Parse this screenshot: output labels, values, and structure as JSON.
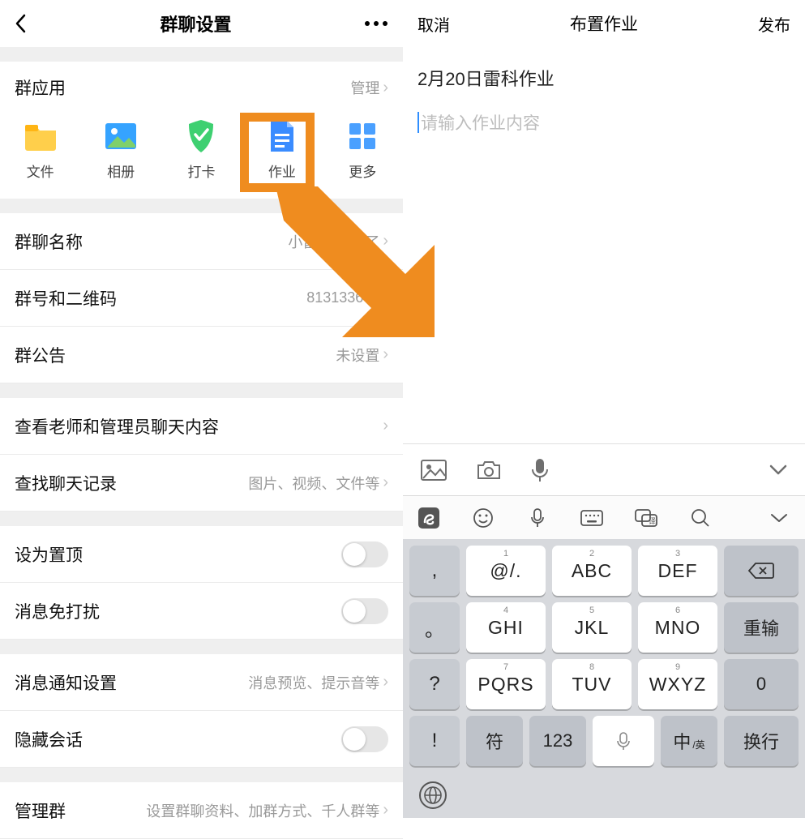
{
  "left": {
    "header_title": "群聊设置",
    "apps_section": {
      "title": "群应用",
      "manage": "管理"
    },
    "apps": [
      {
        "label": "文件"
      },
      {
        "label": "相册"
      },
      {
        "label": "打卡"
      },
      {
        "label": "作业"
      },
      {
        "label": "更多"
      }
    ],
    "rows": {
      "name": {
        "label": "群聊名称",
        "value": "小雷      堂开课了"
      },
      "id": {
        "label": "群号和二维码",
        "value": "813133646"
      },
      "announce": {
        "label": "群公告",
        "value": "未设置"
      },
      "view_admin": {
        "label": "查看老师和管理员聊天内容"
      },
      "search": {
        "label": "查找聊天记录",
        "value": "图片、视频、文件等"
      },
      "pin": {
        "label": "设为置顶"
      },
      "mute": {
        "label": "消息免打扰"
      },
      "notify": {
        "label": "消息通知设置",
        "value": "消息预览、提示音等"
      },
      "hide": {
        "label": "隐藏会话"
      },
      "manage": {
        "label": "管理群",
        "value": "设置群聊资料、加群方式、千人群等"
      }
    }
  },
  "right": {
    "cancel": "取消",
    "title": "布置作业",
    "publish": "发布",
    "subject": "2月20日雷科作业",
    "body_placeholder": "请输入作业内容"
  },
  "keyboard": {
    "punct": [
      ",",
      "。",
      "?",
      "!"
    ],
    "keys": [
      {
        "sup": "1",
        "main": "@/."
      },
      {
        "sup": "2",
        "main": "ABC"
      },
      {
        "sup": "3",
        "main": "DEF"
      },
      {
        "sup": "4",
        "main": "GHI"
      },
      {
        "sup": "5",
        "main": "JKL"
      },
      {
        "sup": "6",
        "main": "MNO"
      },
      {
        "sup": "7",
        "main": "PQRS"
      },
      {
        "sup": "8",
        "main": "TUV"
      },
      {
        "sup": "9",
        "main": "WXYZ"
      }
    ],
    "retype": "重输",
    "zero": "0",
    "symbol": "符",
    "num": "123",
    "lang_main": "中",
    "lang_sub": "/英",
    "enter": "换行"
  }
}
